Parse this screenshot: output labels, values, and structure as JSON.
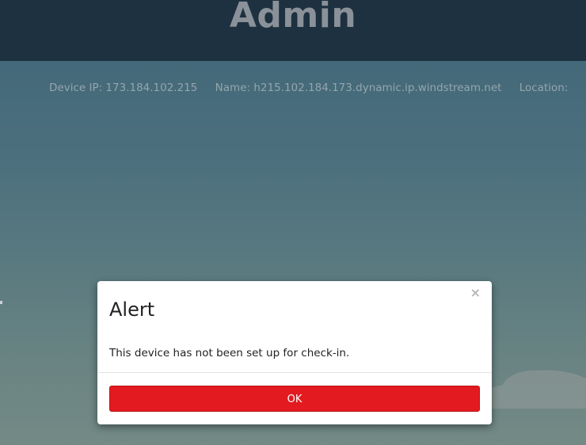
{
  "header": {
    "title": "Admin"
  },
  "device_info": {
    "ip": "Device IP: 173.184.102.215",
    "name": "Name: h215.102.184.173.dynamic.ip.windstream.net",
    "location": "Location:"
  },
  "alert": {
    "title": "Alert",
    "message": "This device has not been set up for check-in.",
    "close_glyph": "×",
    "ok_label": "OK"
  },
  "colors": {
    "header_bg": "#1d3140",
    "ok_button": "#e31a1f",
    "background_top": "#3f6577",
    "background_bottom": "#738a86"
  }
}
